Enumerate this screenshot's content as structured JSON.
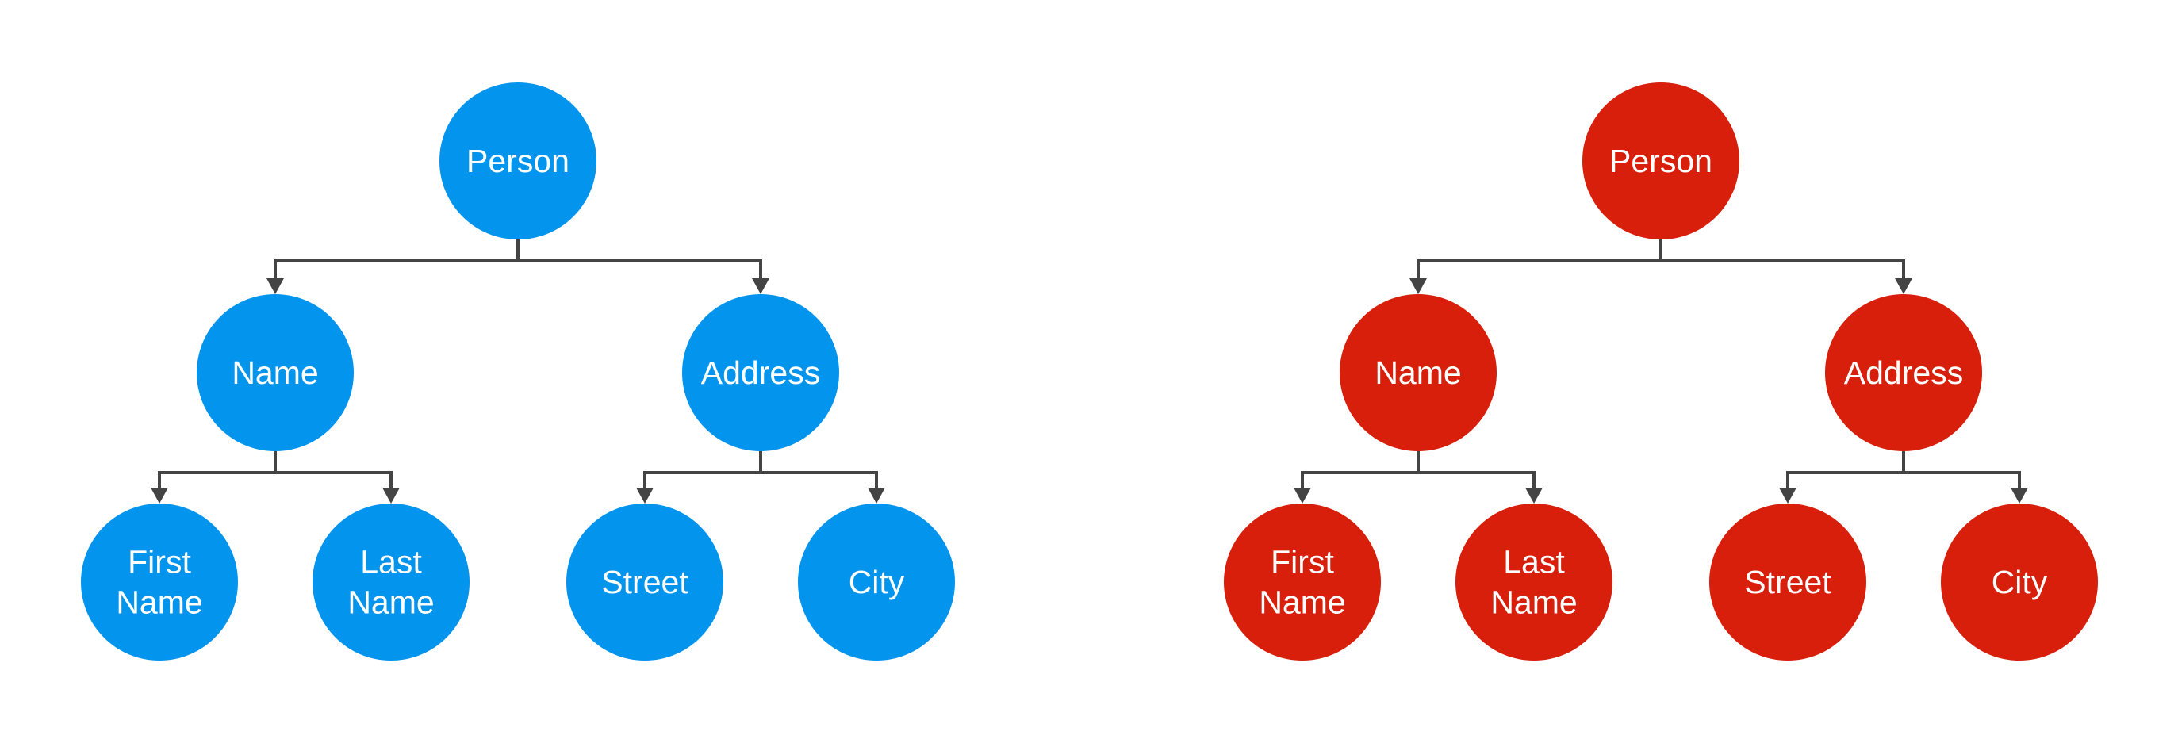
{
  "diagram": {
    "type": "tree",
    "connector_color": "#444444",
    "label_color": "#ffffff",
    "trees": [
      {
        "id": "blue-tree",
        "fill": "#0394EE",
        "root": {
          "label": [
            "Person"
          ],
          "children": [
            {
              "label": [
                "Name"
              ],
              "children": [
                {
                  "label": [
                    "First",
                    "Name"
                  ],
                  "children": []
                },
                {
                  "label": [
                    "Last",
                    "Name"
                  ],
                  "children": []
                }
              ]
            },
            {
              "label": [
                "Address"
              ],
              "children": [
                {
                  "label": [
                    "Street"
                  ],
                  "children": []
                },
                {
                  "label": [
                    "City"
                  ],
                  "children": []
                }
              ]
            }
          ]
        }
      },
      {
        "id": "red-tree",
        "fill": "#D81F0C",
        "root": {
          "label": [
            "Person"
          ],
          "children": [
            {
              "label": [
                "Name"
              ],
              "children": [
                {
                  "label": [
                    "First",
                    "Name"
                  ],
                  "children": []
                },
                {
                  "label": [
                    "Last",
                    "Name"
                  ],
                  "children": []
                }
              ]
            },
            {
              "label": [
                "Address"
              ],
              "children": [
                {
                  "label": [
                    "Street"
                  ],
                  "children": []
                },
                {
                  "label": [
                    "City"
                  ],
                  "children": []
                }
              ]
            }
          ]
        }
      }
    ]
  }
}
